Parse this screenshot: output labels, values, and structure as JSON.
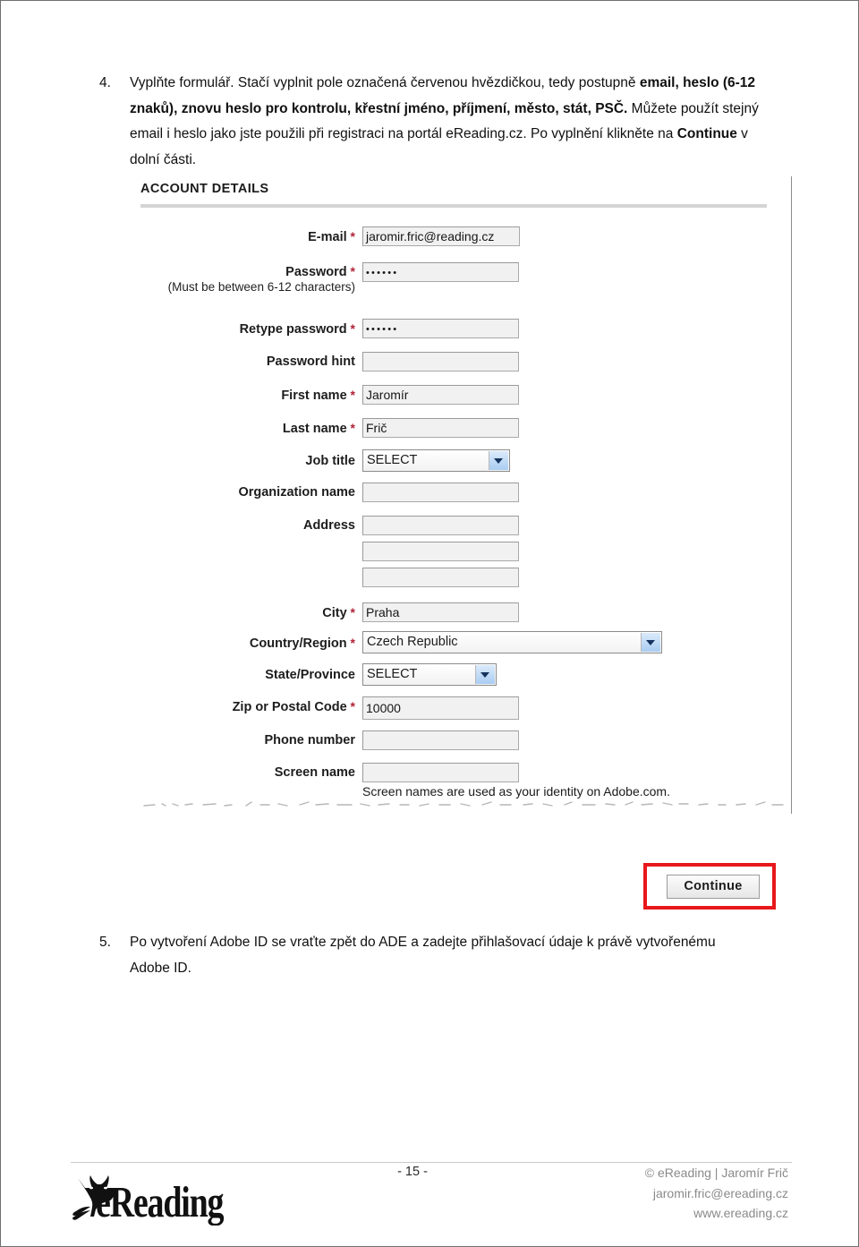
{
  "document": {
    "page_number": "- 15 -"
  },
  "steps": [
    {
      "number": "4.",
      "segments": [
        {
          "text": "Vyplňte formulář. Stačí vyplnit pole označená červenou hvězdičkou, tedy postupně ",
          "bold": false
        },
        {
          "text": "email, heslo (6-12 znaků), znovu heslo pro kontrolu, křestní jméno, příjmení, město, stát, PSČ.",
          "bold": true
        },
        {
          "text": " Můžete použít stejný email i heslo jako jste použili při registraci na portál eReading.cz. Po vyplnění klikněte na ",
          "bold": false
        },
        {
          "text": "Continue",
          "bold": true
        },
        {
          "text": " v dolní části.",
          "bold": false
        }
      ]
    },
    {
      "number": "5.",
      "segments": [
        {
          "text": "Po vytvoření Adobe ID se vraťte zpět do ADE a zadejte přihlašovací údaje k právě vytvořenému  Adobe ID.",
          "bold": false
        }
      ]
    }
  ],
  "screenshot": {
    "section_title": "ACCOUNT DETAILS",
    "fields": [
      {
        "name": "email",
        "label": "E-mail",
        "required": true,
        "control": "text",
        "value": "jaromir.fric@reading.cz"
      },
      {
        "name": "password",
        "label": "Password",
        "sublabel": "(Must be between 6-12 characters)",
        "required": true,
        "control": "password",
        "value": "••••••"
      },
      {
        "name": "retype-password",
        "label": "Retype password",
        "required": true,
        "control": "password",
        "value": "••••••"
      },
      {
        "name": "password-hint",
        "label": "Password hint",
        "required": false,
        "control": "text",
        "value": ""
      },
      {
        "name": "first-name",
        "label": "First name",
        "required": true,
        "control": "text",
        "value": "Jaromír"
      },
      {
        "name": "last-name",
        "label": "Last name",
        "required": true,
        "control": "text",
        "value": "Frič"
      },
      {
        "name": "job-title",
        "label": "Job title",
        "required": false,
        "control": "select",
        "value": "SELECT"
      },
      {
        "name": "organization-name",
        "label": "Organization name",
        "required": false,
        "control": "text",
        "value": ""
      },
      {
        "name": "address",
        "label": "Address",
        "required": false,
        "control": "text-multi",
        "value": ""
      },
      {
        "name": "city",
        "label": "City",
        "required": true,
        "control": "text",
        "value": "Praha"
      },
      {
        "name": "country-region",
        "label": "Country/Region",
        "required": true,
        "control": "select",
        "value": "Czech Republic"
      },
      {
        "name": "state-province",
        "label": "State/Province",
        "required": false,
        "control": "select",
        "value": "SELECT"
      },
      {
        "name": "zip-postal-code",
        "label": "Zip or Postal Code",
        "required": true,
        "control": "text",
        "value": "10000"
      },
      {
        "name": "phone-number",
        "label": "Phone number",
        "required": false,
        "control": "text",
        "value": ""
      },
      {
        "name": "screen-name",
        "label": "Screen name",
        "required": false,
        "control": "text",
        "value": ""
      }
    ],
    "screen_name_hint": "Screen names are used as your identity on Adobe.com.",
    "continue_label": "Continue",
    "highlight_color": "#e8171b"
  },
  "footer": {
    "logo_text": "eReading",
    "copyright": "© eReading |  Jaromír Frič",
    "email": "jaromir.fric@ereading.cz",
    "website": "www.ereading.cz"
  }
}
